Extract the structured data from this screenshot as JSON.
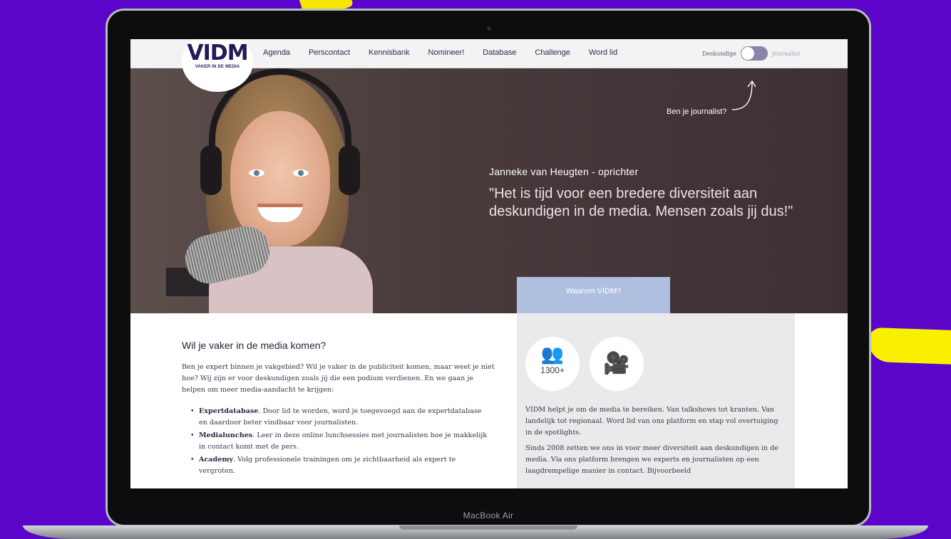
{
  "device": {
    "model_label": "MacBook Air"
  },
  "colors": {
    "background": "#5a05c9",
    "accent_yellow": "#f6e600",
    "button": "#aebfe0",
    "brand_purple": "#5b1f6e"
  },
  "nav": {
    "logo_main": "VIDM",
    "logo_sub": "VAKER IN DE MEDIA",
    "items": [
      "Agenda",
      "Perscontact",
      "Kennisbank",
      "Nomineer!",
      "Database",
      "Challenge",
      "Word lid"
    ],
    "toggle_left_label": "Deskundige",
    "toggle_right_label": "Journalist"
  },
  "hero": {
    "hint": "Ben je journalist?",
    "name": "Janneke van Heugten - oprichter",
    "quote": "\"Het is tijd voor een bredere diversiteit aan deskundigen in de media. Mensen zoals jij dus!\"",
    "button_label": "Waarom VIDM?"
  },
  "main": {
    "title": "Wil je vaker in de media komen?",
    "intro": "Ben je expert binnen je vakgebied? Wil je vaker in de publiciteit komen, maar weet je niet hoe? Wij zijn er voor deskundigen zoals jij die een podium verdienen. En we gaan je helpen om meer media-aandacht te krijgen:",
    "bullets": [
      {
        "term": "Expertdatabase",
        "text": ". Door lid te worden, word je toegevoegd aan de expertdatabase en daardoor beter vindbaar voor journalisten."
      },
      {
        "term": "Medialunches",
        "text": ". Leer in deze online lunchsessies met journalisten hoe je makkelijk in contact komt met de pers."
      },
      {
        "term": "Academy",
        "text": ". Volg professionele trainingen om je zichtbaarheid als expert te vergroten."
      }
    ]
  },
  "side": {
    "members_count": "1300+",
    "icons": [
      "people-group-icon",
      "media-camera-icon"
    ],
    "text_1": "VIDM helpt je om de media te bereiken. Van talkshows tot kranten. Van landelijk tot regionaal. Word lid van ons platform en stap vol overtuiging in de spotlights.",
    "text_2": "Sinds 2008 zetten we ons in voor meer diversiteit aan deskundigen in de media. Via ons platform brengen we experts en journalisten op een laagdrempelige manier in contact. Bijvoorbeeld"
  }
}
